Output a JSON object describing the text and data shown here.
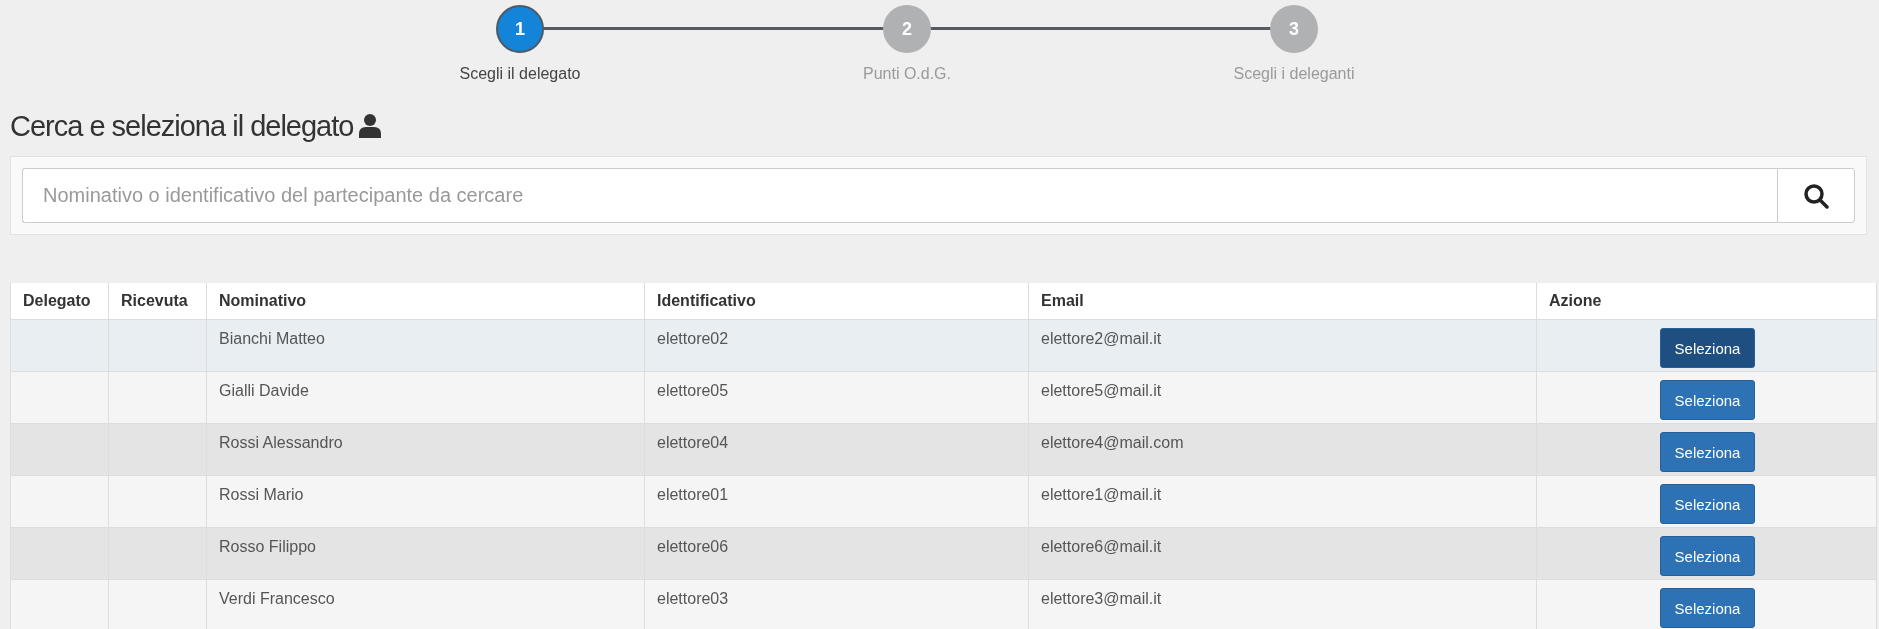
{
  "stepper": [
    {
      "number": "1",
      "label": "Scegli il delegato",
      "selected": true
    },
    {
      "number": "2",
      "label": "Punti O.d.G.",
      "selected": false
    },
    {
      "number": "3",
      "label": "Scegli i deleganti",
      "selected": false
    }
  ],
  "heading": "Cerca e seleziona il delegato",
  "search": {
    "placeholder": "Nominativo o identificativo del partecipante da cercare"
  },
  "table": {
    "columns": [
      "Delegato",
      "Ricevuta",
      "Nominativo",
      "Identificativo",
      "Email",
      "Azione"
    ],
    "rows": [
      {
        "nominativo": "Bianchi Matteo",
        "identificativo": "elettore02",
        "email": "elettore2@mail.it",
        "action": "Seleziona",
        "hovered": true
      },
      {
        "nominativo": "Gialli Davide",
        "identificativo": "elettore05",
        "email": "elettore5@mail.it",
        "action": "Seleziona",
        "hovered": false
      },
      {
        "nominativo": "Rossi Alessandro",
        "identificativo": "elettore04",
        "email": "elettore4@mail.com",
        "action": "Seleziona",
        "hovered": false
      },
      {
        "nominativo": "Rossi Mario",
        "identificativo": "elettore01",
        "email": "elettore1@mail.it",
        "action": "Seleziona",
        "hovered": false
      },
      {
        "nominativo": "Rosso Filippo",
        "identificativo": "elettore06",
        "email": "elettore6@mail.it",
        "action": "Seleziona",
        "hovered": false
      },
      {
        "nominativo": "Verdi Francesco",
        "identificativo": "elettore03",
        "email": "elettore3@mail.it",
        "action": "Seleziona",
        "hovered": false
      }
    ]
  }
}
